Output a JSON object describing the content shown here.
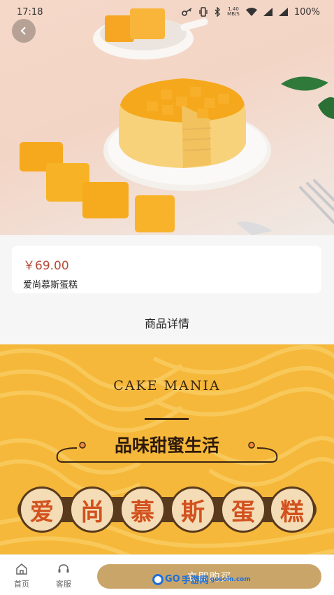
{
  "status_bar": {
    "time": "17:18",
    "net_speed_value": "1.40",
    "net_speed_unit": "MB/S",
    "battery": "100%",
    "icons": [
      "key-icon",
      "vibrate-icon",
      "bluetooth-icon",
      "wifi-icon",
      "signal-icon",
      "signal-icon",
      "battery-icon"
    ]
  },
  "header": {
    "back_icon": "chevron-left-icon"
  },
  "product": {
    "price": "￥69.00",
    "name": "爱尚慕斯蛋糕"
  },
  "detail": {
    "title": "商品详情",
    "banner_en": "CAKE MANIA",
    "slogan": "品味甜蜜生活",
    "big_title_chars": [
      "爱",
      "尚",
      "慕",
      "斯",
      "蛋",
      "糕"
    ]
  },
  "bottom_nav": {
    "home_label": "首页",
    "service_label": "客服",
    "buy_label": "立即购买"
  },
  "watermark": {
    "brand": "GO",
    "suffix": "手游网",
    "sub": "gosoin.com"
  },
  "colors": {
    "price": "#b54d3a",
    "banner_bg": "#f5b83a",
    "buy_button": "#c9a569",
    "title_char": "#d2511e"
  }
}
